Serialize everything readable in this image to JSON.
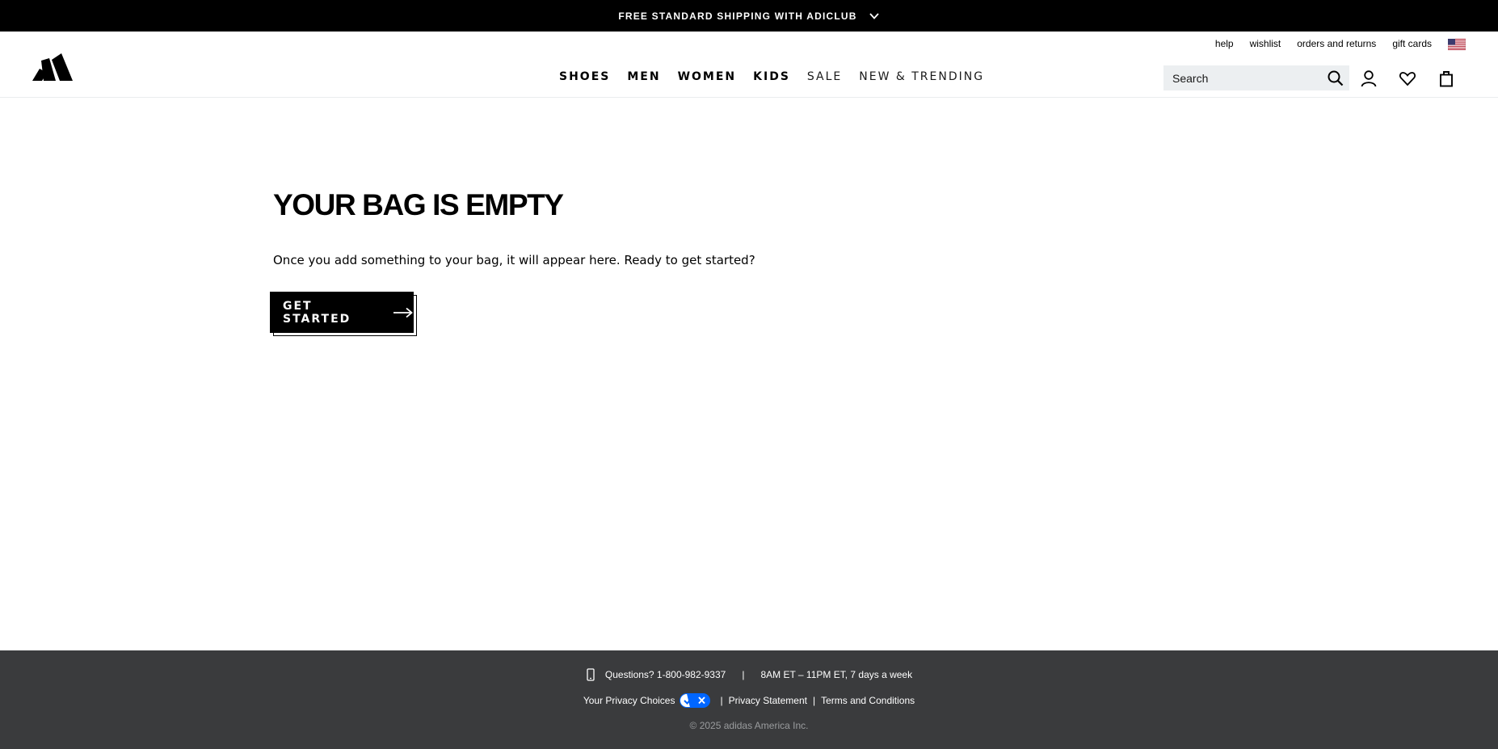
{
  "promo": {
    "text": "FREE STANDARD SHIPPING WITH ADICLUB",
    "chevron_icon": "chevron-down-icon"
  },
  "header": {
    "logo": "adidas-logo",
    "utility_links": [
      "help",
      "wishlist",
      "orders and returns",
      "gift cards"
    ],
    "flag_icon": "us-flag-icon",
    "nav": [
      {
        "label": "SHOES",
        "style": "bold"
      },
      {
        "label": "MEN",
        "style": "bold"
      },
      {
        "label": "WOMEN",
        "style": "bold"
      },
      {
        "label": "KIDS",
        "style": "bold"
      },
      {
        "label": "SALE",
        "style": "light"
      },
      {
        "label": "NEW & TRENDING",
        "style": "light"
      }
    ],
    "search": {
      "placeholder": "Search",
      "value": ""
    },
    "icons": [
      "search-icon",
      "account-icon",
      "wishlist-heart-icon",
      "bag-icon"
    ]
  },
  "main": {
    "title": "YOUR BAG IS EMPTY",
    "description": "Once you add something to your bag, it will appear here. Ready to get started?",
    "cta_label": "GET STARTED"
  },
  "footer": {
    "questions": "Questions? 1-800-982-9337",
    "separator": "|",
    "hours": "8AM ET – 11PM ET, 7 days a week",
    "privacy_choices": "Your Privacy Choices",
    "privacy_statement": "Privacy Statement",
    "terms": "Terms and Conditions",
    "copyright": "© 2025 adidas America Inc."
  },
  "colors": {
    "footer_bg": "#3a3b3d",
    "search_bg": "#eceff1",
    "privacy_toggle": "#0066ff"
  }
}
